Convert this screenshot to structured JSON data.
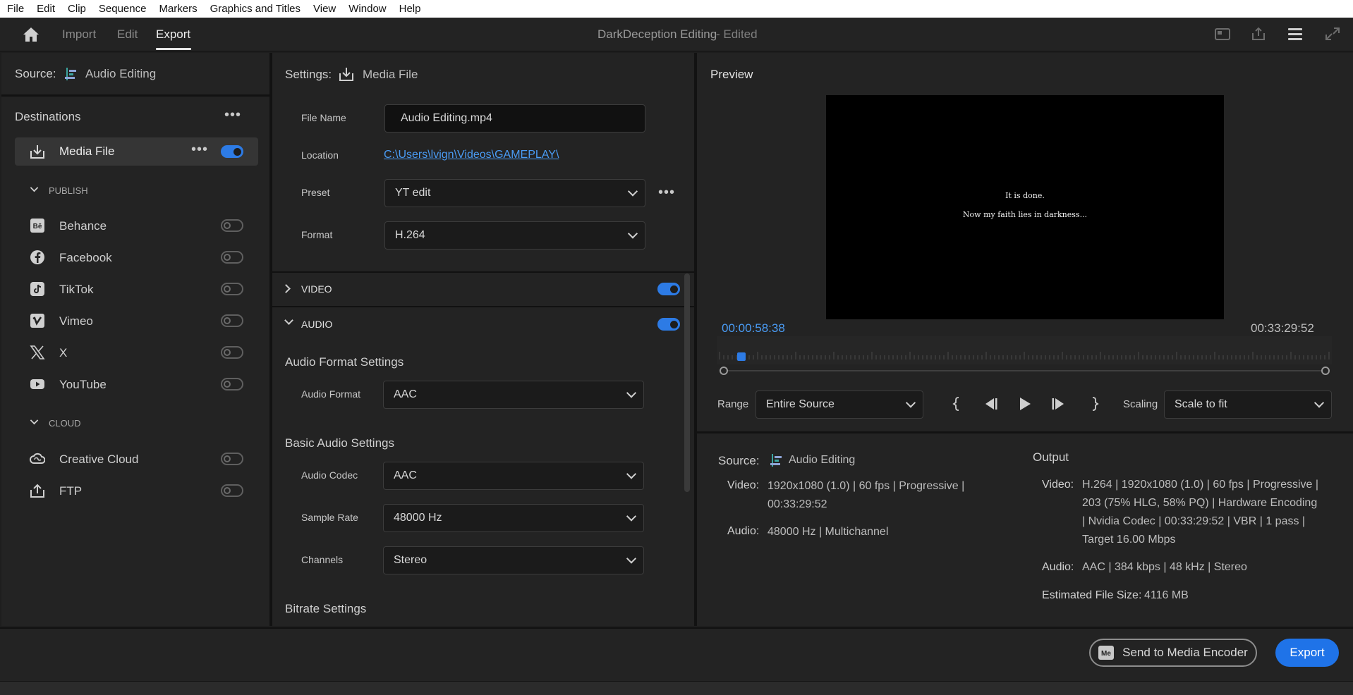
{
  "menu": [
    "File",
    "Edit",
    "Clip",
    "Sequence",
    "Markers",
    "Graphics and Titles",
    "View",
    "Window",
    "Help"
  ],
  "header": {
    "tabs": [
      "Import",
      "Edit",
      "Export"
    ],
    "active_tab": "Export",
    "project_title": "DarkDeception Editing",
    "edited_status": "- Edited"
  },
  "source": {
    "label": "Source:",
    "name": "Audio Editing"
  },
  "destinations": {
    "title": "Destinations",
    "media_file": {
      "label": "Media File",
      "enabled": true
    },
    "publish_label": "PUBLISH",
    "publish": [
      {
        "label": "Behance",
        "icon": "behance-icon",
        "enabled": false
      },
      {
        "label": "Facebook",
        "icon": "facebook-icon",
        "enabled": false
      },
      {
        "label": "TikTok",
        "icon": "tiktok-icon",
        "enabled": false
      },
      {
        "label": "Vimeo",
        "icon": "vimeo-icon",
        "enabled": false
      },
      {
        "label": "X",
        "icon": "x-icon",
        "enabled": false
      },
      {
        "label": "YouTube",
        "icon": "youtube-icon",
        "enabled": false
      }
    ],
    "cloud_label": "CLOUD",
    "cloud": [
      {
        "label": "Creative Cloud",
        "icon": "creative-cloud-icon",
        "enabled": false
      },
      {
        "label": "FTP",
        "icon": "ftp-icon",
        "enabled": false
      }
    ]
  },
  "settings": {
    "label": "Settings:",
    "target": "Media File",
    "file_name_label": "File Name",
    "file_name": "Audio Editing.mp4",
    "location_label": "Location",
    "location": "C:\\Users\\lvign\\Videos\\GAMEPLAY\\",
    "preset_label": "Preset",
    "preset": "YT edit",
    "format_label": "Format",
    "format": "H.264",
    "video_section": "VIDEO",
    "video_enabled": true,
    "audio_section": "AUDIO",
    "audio_enabled": true,
    "audio_format_settings": "Audio Format Settings",
    "audio_format_label": "Audio Format",
    "audio_format": "AAC",
    "basic_audio_settings": "Basic Audio Settings",
    "audio_codec_label": "Audio Codec",
    "audio_codec": "AAC",
    "sample_rate_label": "Sample Rate",
    "sample_rate": "48000 Hz",
    "channels_label": "Channels",
    "channels": "Stereo",
    "bitrate_settings": "Bitrate Settings"
  },
  "preview": {
    "title": "Preview",
    "caption_line1": "It is done.",
    "caption_line2": "Now my faith lies in darkness...",
    "current_time": "00:00:58:38",
    "duration": "00:33:29:52",
    "playhead_fraction": 0.029,
    "range_label": "Range",
    "range": "Entire Source",
    "scaling_label": "Scaling",
    "scaling": "Scale to fit"
  },
  "summary": {
    "source_label": "Source:",
    "source_name": "Audio Editing",
    "video_label": "Video:",
    "source_video": "1920x1080 (1.0)  |  60 fps  |  Progressive  |  00:33:29:52",
    "audio_label": "Audio:",
    "source_audio": "48000 Hz  |  Multichannel",
    "output_label": "Output",
    "output_video": "H.264  |  1920x1080 (1.0)  |  60 fps  |  Progressive  |  203 (75% HLG, 58% PQ)  |  Hardware Encoding  |  Nvidia Codec  |  00:33:29:52   |  VBR  |  1 pass  |  Target 16.00 Mbps",
    "output_audio": "AAC  |  384 kbps  |  48 kHz  |  Stereo",
    "file_size_label": "Estimated File Size:",
    "file_size": "4116 MB"
  },
  "footer": {
    "encoder_label": "Send to Media Encoder",
    "export_label": "Export"
  },
  "colors": {
    "accent": "#2d7be5",
    "export_button": "#1f73e8",
    "link": "#4a9cf5",
    "timecode": "#4a9cf5"
  }
}
